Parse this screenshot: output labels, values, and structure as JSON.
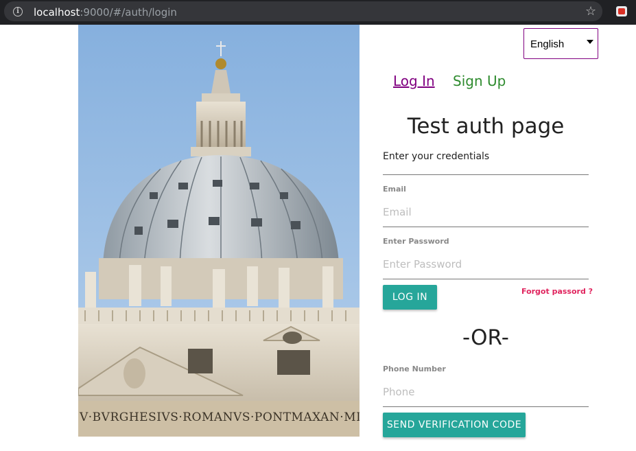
{
  "browser": {
    "url_host": "localhost",
    "url_rest": ":9000/#/auth/login",
    "info_icon": "info-icon",
    "star_icon": "star-icon",
    "extension_icon": "extension-icon"
  },
  "picture": {
    "subject": "St. Peter's Basilica dome",
    "inscription": "V·BVRGHESIVS·ROMANVS·PONTMAXAN·MD C X"
  },
  "language": {
    "selected": "English"
  },
  "tabs": {
    "login": "Log In",
    "signup": "Sign Up"
  },
  "form": {
    "title": "Test auth page",
    "subtitle": "Enter your credentials",
    "email_label": "Email",
    "email_placeholder": "Email",
    "password_label": "Enter Password",
    "password_placeholder": "Enter Password",
    "login_button": "LOG IN",
    "forgot_link": "Forgot passord ?",
    "or_separator": "-OR-",
    "phone_label": "Phone Number",
    "phone_placeholder": "Phone",
    "send_code_button": "SEND VERIFICATION CODE"
  },
  "colors": {
    "accent": "#26a69a",
    "link_visited": "#800080",
    "signup_link": "#2e8b2e",
    "forgot_link": "#e0245e"
  }
}
